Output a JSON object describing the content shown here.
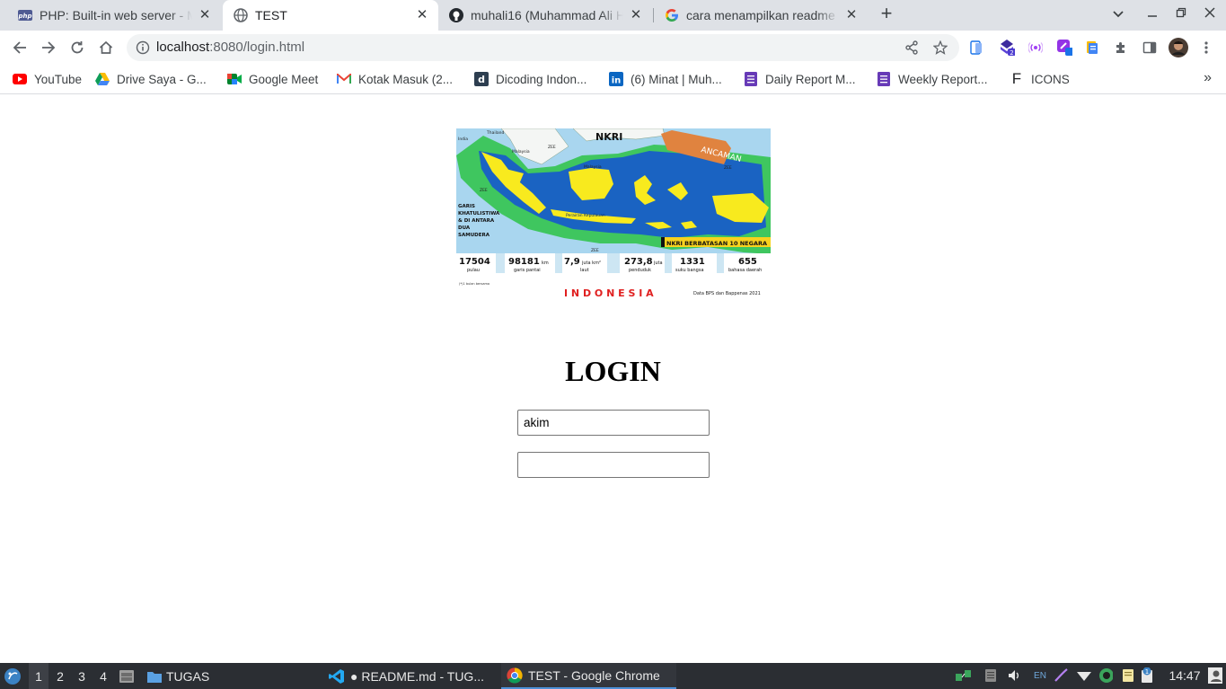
{
  "browser": {
    "tabs": [
      {
        "title": "PHP: Built-in web server - Manual",
        "favicon": "php-icon",
        "active": false
      },
      {
        "title": "TEST",
        "favicon": "globe-icon",
        "active": true
      },
      {
        "title": "muhali16 (Muhammad Ali Hakim)",
        "favicon": "github-icon",
        "active": false
      },
      {
        "title": "cara menampilkan readme",
        "favicon": "google-icon",
        "active": false
      }
    ],
    "new_tab_icon": "plus-icon",
    "address": {
      "host": "localhost",
      "rest": ":8080/login.html"
    },
    "bookmarks": [
      {
        "label": "YouTube",
        "icon": "youtube-icon"
      },
      {
        "label": "Drive Saya - G...",
        "icon": "google-drive-icon"
      },
      {
        "label": "Google Meet",
        "icon": "google-meet-icon"
      },
      {
        "label": "Kotak Masuk (2...",
        "icon": "gmail-icon"
      },
      {
        "label": "Dicoding Indon...",
        "icon": "dicoding-icon"
      },
      {
        "label": "(6) Minat | Muh...",
        "icon": "linkedin-icon"
      },
      {
        "label": "Daily Report M...",
        "icon": "form-icon"
      },
      {
        "label": "Weekly Report...",
        "icon": "form-icon"
      },
      {
        "label": "ICONS",
        "icon": "letter-f-icon"
      }
    ]
  },
  "page": {
    "map": {
      "title": "NKRI",
      "threat": "ANCAMAN",
      "equator_text": [
        "GARIS",
        "KHATULISTIWA",
        "& DI ANTARA",
        "DUA",
        "SAMUDERA"
      ],
      "border_text": "NKRI BERBATASAN 10 NEGARA",
      "country_labels": [
        "India",
        "Thailand",
        "Malaysia",
        "Malaysia",
        "ZEE",
        "ZEE",
        "ZEE",
        "ZEE",
        "Perairan Kepulauan"
      ],
      "stats": [
        {
          "value": "17504",
          "unit": "",
          "label": "pulau"
        },
        {
          "value": "98181",
          "unit": "km",
          "label": "garis pantai"
        },
        {
          "value": "7,9",
          "unit": "juta km²",
          "label": "laut"
        },
        {
          "value": "273,8",
          "unit": "juta",
          "label": "penduduk"
        },
        {
          "value": "1331",
          "unit": "",
          "label": "suku bangsa"
        },
        {
          "value": "655",
          "unit": "",
          "label": "bahasa daerah"
        }
      ],
      "footnote": "(*)1 bulan bersama",
      "country": "I N D O N E S I A",
      "source": "Data BPS dan Bappenas 2021"
    },
    "login_title": "LOGIN",
    "username_value": "akim",
    "password_value": ""
  },
  "taskbar": {
    "workspaces": [
      "1",
      "2",
      "3",
      "4"
    ],
    "folder": "TUGAS",
    "windows": [
      {
        "label": "● README.md - TUG...",
        "icon": "vscode-icon",
        "active": false
      },
      {
        "label": "TEST - Google Chrome",
        "icon": "chrome-icon",
        "active": true
      }
    ],
    "keyboard": "EN",
    "notification_count": "1",
    "time": "14:47"
  }
}
